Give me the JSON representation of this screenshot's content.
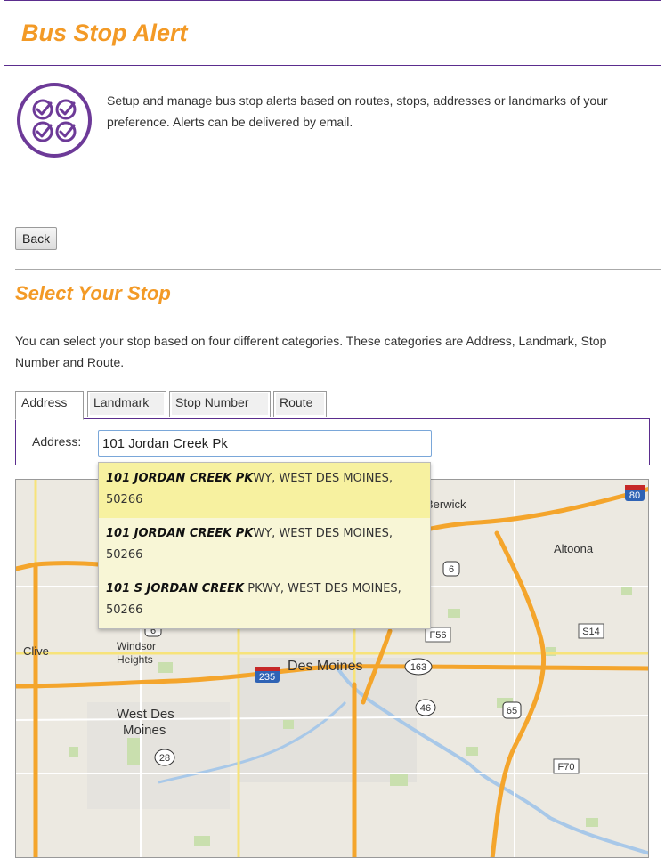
{
  "header": {
    "title": "Bus Stop Alert"
  },
  "intro": {
    "icon": "checkmarks-circle-icon",
    "text": "Setup and manage bus stop alerts based on routes, stops, addresses or landmarks of your preference. Alerts can be delivered by email."
  },
  "back_label": "Back",
  "section": {
    "title": "Select Your Stop",
    "text": "You can select your stop based on four different categories. These categories are Address, Landmark, Stop Number and Route."
  },
  "tabs": [
    "Address",
    "Landmark",
    "Stop Number",
    "Route"
  ],
  "active_tab": "Address",
  "address": {
    "label": "Address:",
    "value": "101 Jordan Creek Pk"
  },
  "suggestions": [
    {
      "match": "101 JORDAN CREEK PK",
      "rest": "WY, WEST DES MOINES, 50266"
    },
    {
      "match": "101 JORDAN CREEK PK",
      "rest": "WY, WEST DES MOINES, 50266"
    },
    {
      "match": "101 S JORDAN CREEK",
      "rest": " PKWY, WEST DES MOINES, 50266"
    }
  ],
  "map": {
    "labels": {
      "berwick": "Berwick",
      "altoona": "Altoona",
      "clive": "Clive",
      "windsor": "Windsor",
      "heights": "Heights",
      "des_moines": "Des Moines",
      "west_des": "West Des",
      "moines": "Moines"
    },
    "shields": {
      "i80": "80",
      "i235": "235",
      "r6": "6",
      "r6b": "6",
      "f56": "F56",
      "s14": "S14",
      "r163": "163",
      "r46": "46",
      "r65": "65",
      "r28": "28",
      "f70": "F70"
    }
  },
  "colors": {
    "accent": "#f39a26",
    "border": "#5b2d8e",
    "suggest_bg": "#f8f6d6",
    "suggest_hl": "#f7f1a0",
    "map_bg": "#ece9e1",
    "road": "#f4a52c"
  }
}
